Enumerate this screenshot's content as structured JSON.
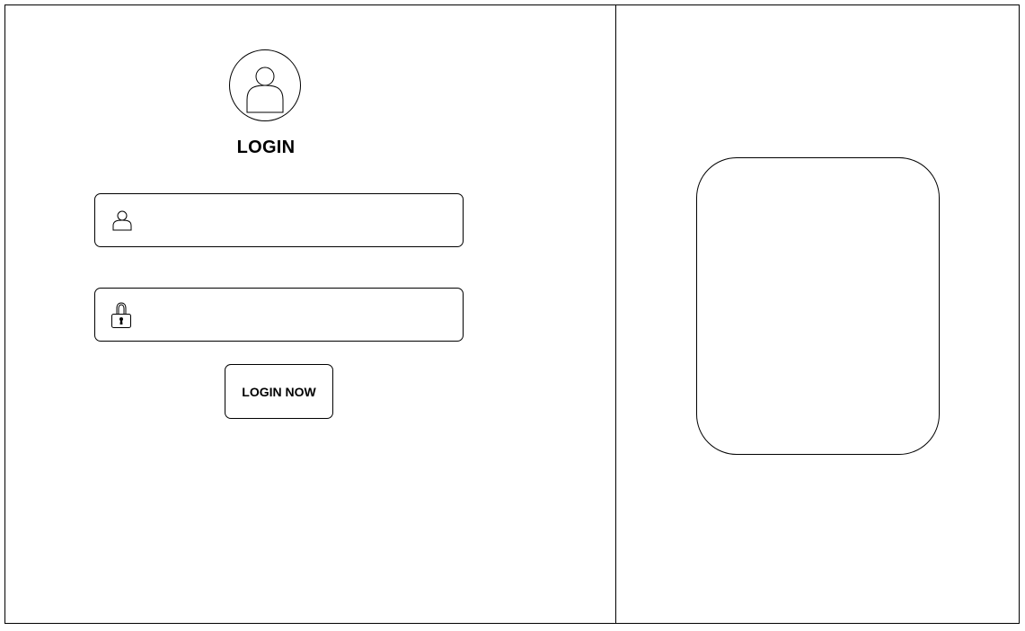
{
  "login": {
    "title": "LOGIN",
    "avatar_icon": "user-avatar-icon",
    "username_field": {
      "icon": "user-icon",
      "value": "",
      "placeholder": ""
    },
    "password_field": {
      "icon": "lock-icon",
      "value": "",
      "placeholder": ""
    },
    "submit_label": "LOGIN NOW"
  },
  "colors": {
    "stroke": "#000000",
    "background": "#ffffff"
  }
}
